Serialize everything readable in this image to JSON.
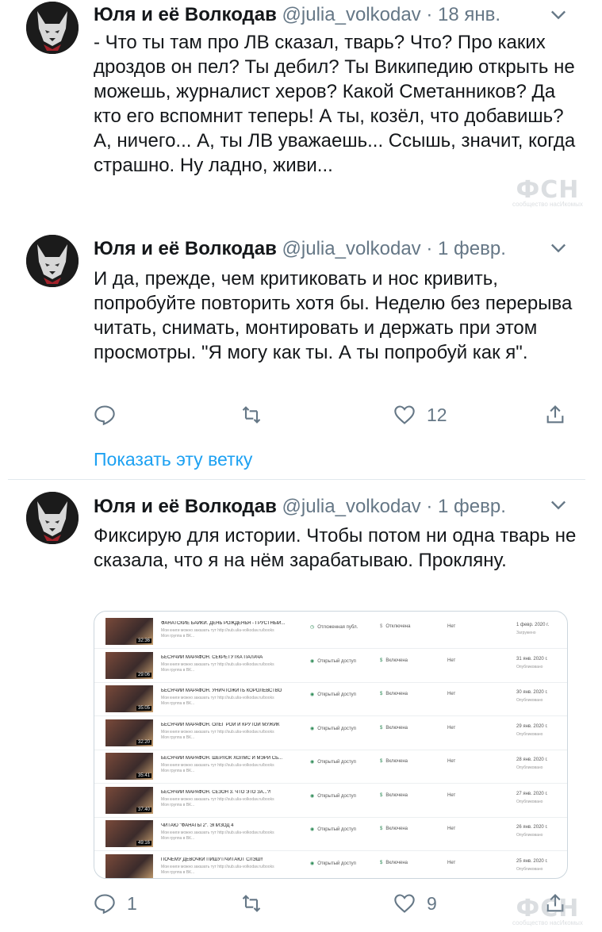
{
  "tweets": [
    {
      "name": "Юля и её Волкодав",
      "handle": "@julia_volkodav",
      "date": "18 янв.",
      "text": "- Что ты там про ЛВ сказал, тварь? Что? Про каких дроздов он пел? Ты дебил? Ты Википедию открыть не можешь, журналист херов? Какой Сметанников? Да кто его вспомнит теперь! А ты, козёл, что добавишь? А, ничего... А, ты ЛВ уважаешь... Ссышь, значит, когда страшно. Ну ладно, живи..."
    },
    {
      "name": "Юля и её Волкодав",
      "handle": "@julia_volkodav",
      "date": "1 февр.",
      "text": "И да, прежде, чем критиковать и нос кривить, попробуйте повторить хотя бы. Неделю без перерыва читать, снимать, монтировать и держать при этом просмотры. \"Я могу как ты. А ты попробуй как я\".",
      "likes": "12",
      "show_thread": "Показать эту ветку"
    },
    {
      "name": "Юля и её Волкодав",
      "handle": "@julia_volkodav",
      "date": "1 февр.",
      "text": "Фиксирую для истории. Чтобы потом ни одна тварь не сказала, что я на нём зарабатываю. Прокляну.",
      "replies": "1",
      "likes": "9"
    }
  ],
  "separator": "·",
  "videos": [
    {
      "title": "ФАНАТСКИЕ БАЙКИ. ДЕНЬ РОЖДЕНЬЯ - ГРУСТНЫЙ...",
      "desc": "Мои книги можно заказать тут http://sub.ulia-volkodav.ru/books Моя группа в ВК...",
      "duration": "32:36",
      "visibility": "Отложенная публ.",
      "monetization": "Отключена",
      "restrictions": "Нет",
      "date": "1 февр. 2020 г.",
      "status": "Загружено"
    },
    {
      "title": "БЕСЯЧИЙ МАРАФОН. СЕКРЕТУТКА ПАЛАЧА",
      "desc": "Мои книги можно заказать тут http://sub.ulia-volkodav.ru/books Моя группа в ВК...",
      "duration": "29:06",
      "visibility": "Открытый доступ",
      "monetization": "Включена",
      "restrictions": "Нет",
      "date": "31 янв. 2020 г.",
      "status": "Опубликовано"
    },
    {
      "title": "БЕСЯЧИЙ МАРАФОН. УНИЧТОЖИТЬ КОРОЛЕВСТВО",
      "desc": "Мои книги можно заказать тут http://sub.ulia-volkodav.ru/books Моя группа в ВК...",
      "duration": "35:05",
      "visibility": "Открытый доступ",
      "monetization": "Включена",
      "restrictions": "Нет",
      "date": "30 янв. 2020 г.",
      "status": "Опубликовано"
    },
    {
      "title": "БЕСЯЧИЙ МАРАФОН. ОЛЕГ РОЙ И КРУТОЙ МУЖИК",
      "desc": "Мои книги можно заказать тут http://sub.ulia-volkodav.ru/books Моя группа в ВК...",
      "duration": "32:20",
      "visibility": "Открытый доступ",
      "monetization": "Включена",
      "restrictions": "Нет",
      "date": "29 янв. 2020 г.",
      "status": "Опубликовано"
    },
    {
      "title": "БЕСЯЧИЙ МАРАФОН. ШЕРЛОК ХОЛМС И МЭРИ СЬ...",
      "desc": "Мои книги можно заказать тут http://sub.ulia-volkodav.ru/books Моя группа в ВК...",
      "duration": "35:41",
      "visibility": "Открытый доступ",
      "monetization": "Включена",
      "restrictions": "Нет",
      "date": "28 янв. 2020 г.",
      "status": "Опубликовано"
    },
    {
      "title": "БЕСЯЧИЙ МАРАФОН. СЕЗОН 3. ЧТО ЭТО ЗА...?!",
      "desc": "Мои книги можно заказать тут http://sub.ulia-volkodav.ru/books Моя группа в ВК...",
      "duration": "37:40",
      "visibility": "Открытый доступ",
      "monetization": "Включена",
      "restrictions": "Нет",
      "date": "27 янв. 2020 г.",
      "status": "Опубликовано"
    },
    {
      "title": "ЧИТАЮ \"ФАНАТЫ 2\". ЭПИЗОД 4",
      "desc": "Мои книги можно заказать тут http://sub.ulia-volkodav.ru/books Моя группа в ВК...",
      "duration": "49:16",
      "visibility": "Открытый доступ",
      "monetization": "Включена",
      "restrictions": "Нет",
      "date": "26 янв. 2020 г.",
      "status": "Опубликовано"
    },
    {
      "title": "ПОЧЕМУ ДЕВОЧКИ ПИШУТ/ЧИТАЮТ СЛЭШ!!",
      "desc": "Мои книги можно заказать тут http://sub.ulia-volkodav.ru/books Моя группа в ВК...",
      "duration": "",
      "visibility": "Открытый доступ",
      "monetization": "Включена",
      "restrictions": "Нет",
      "date": "25 янв. 2020 г.",
      "status": "Опубликовано"
    }
  ],
  "watermark": {
    "logo": "ФСН",
    "subtitle": "сообщество насИкомых"
  },
  "colors": {
    "text": "#14171a",
    "secondary": "#657786",
    "link": "#1da1f2",
    "divider": "#e1e8ed",
    "public_icon": "#2e8b57"
  },
  "icons": [
    "chevron-down-icon",
    "reply-icon",
    "retweet-icon",
    "like-icon",
    "share-icon",
    "avatar-wolf-image",
    "eye-icon",
    "dollar-icon",
    "clock-icon"
  ]
}
